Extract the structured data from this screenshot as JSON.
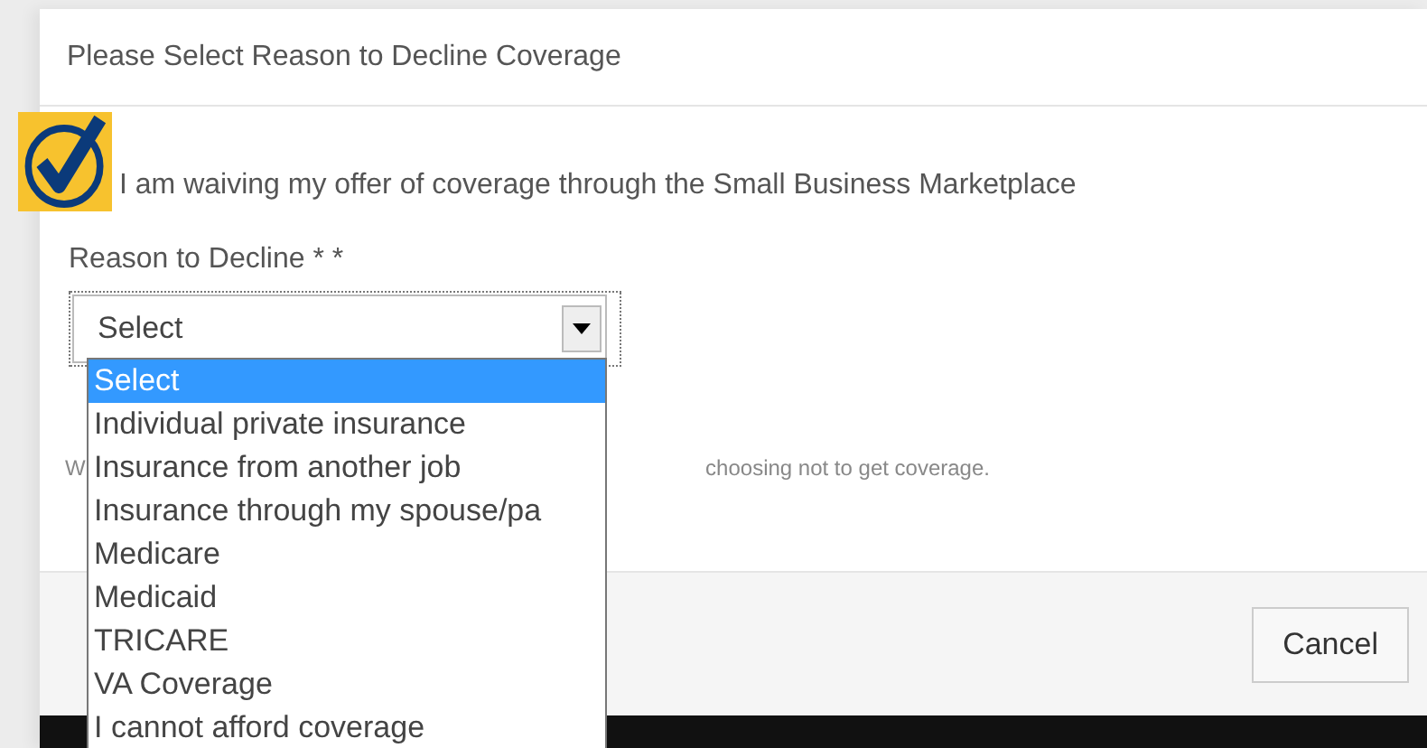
{
  "dialog": {
    "title": "Please Select Reason to Decline Coverage"
  },
  "waiver": {
    "checked": true,
    "label": "I am waiving my offer of coverage through the Small Business Marketplace"
  },
  "reason": {
    "label": "Reason to Decline * *",
    "value": "Select",
    "expanded": true,
    "options": [
      {
        "label": "Select",
        "selected": true
      },
      {
        "label": "Individual private insurance",
        "selected": false
      },
      {
        "label": "Insurance from another job",
        "selected": false
      },
      {
        "label": "Insurance through my spouse/pa",
        "selected": false
      },
      {
        "label": "Medicare",
        "selected": false
      },
      {
        "label": "Medicaid",
        "selected": false
      },
      {
        "label": "TRICARE",
        "selected": false
      },
      {
        "label": "VA Coverage",
        "selected": false
      },
      {
        "label": "I cannot afford coverage",
        "selected": false
      }
    ]
  },
  "help_text": {
    "visible_start": "W",
    "visible_end": "choosing not to get coverage."
  },
  "buttons": [
    "Cancel"
  ]
}
